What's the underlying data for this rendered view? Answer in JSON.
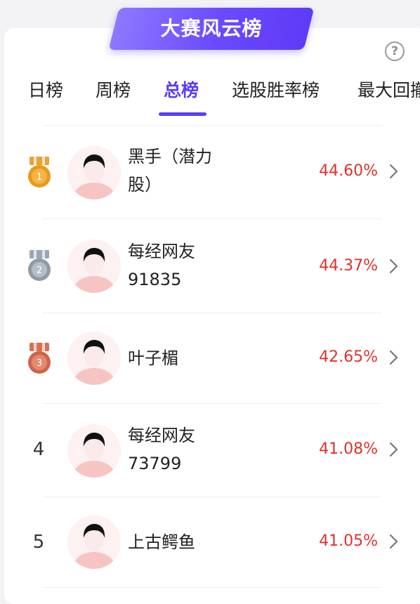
{
  "banner": {
    "title": "大赛风云榜"
  },
  "help": {
    "label": "?"
  },
  "tabs": [
    {
      "label": "日榜",
      "active": false
    },
    {
      "label": "周榜",
      "active": false
    },
    {
      "label": "总榜",
      "active": true
    },
    {
      "label": "选股胜率榜",
      "active": false
    },
    {
      "label": "最大回撤",
      "active": false
    }
  ],
  "leaderboard": [
    {
      "rank": "1",
      "medal": "gold",
      "name": "黑手（潜力股）",
      "return": "44.60%"
    },
    {
      "rank": "2",
      "medal": "silver",
      "name": "每经网友91835",
      "return": "44.37%"
    },
    {
      "rank": "3",
      "medal": "bronze",
      "name": "叶子楣",
      "return": "42.65%"
    },
    {
      "rank": "4",
      "medal": "",
      "name": "每经网友73799",
      "return": "41.08%"
    },
    {
      "rank": "5",
      "medal": "",
      "name": "上古鳄鱼",
      "return": "41.05%"
    }
  ],
  "colors": {
    "accent": "#5b3df5",
    "return_red": "#e0312b",
    "gold": "#e79a1c",
    "silver": "#8e9aa8",
    "bronze": "#d0644a"
  }
}
